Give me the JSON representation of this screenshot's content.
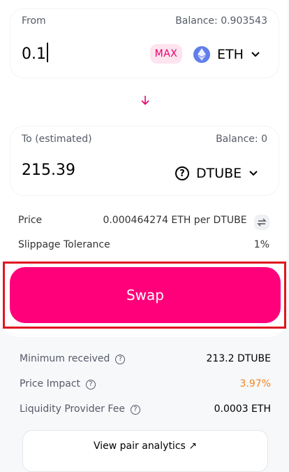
{
  "from": {
    "label": "From",
    "balance": "Balance: 0.903543",
    "amount": "0.1",
    "max_label": "MAX",
    "token": "ETH"
  },
  "to": {
    "label": "To (estimated)",
    "balance": "Balance: 0",
    "amount": "215.39",
    "token": "DTUBE"
  },
  "price": {
    "label": "Price",
    "value": "0.000464274 ETH per DTUBE"
  },
  "slippage": {
    "label": "Slippage Tolerance",
    "value": "1%"
  },
  "swap_label": "Swap",
  "details": {
    "min_received_label": "Minimum received",
    "min_received_value": "213.2 DTUBE",
    "price_impact_label": "Price Impact",
    "price_impact_value": "3.97%",
    "lp_fee_label": "Liquidity Provider Fee",
    "lp_fee_value": "0.0003 ETH"
  },
  "analytics_label": "View pair analytics ↗",
  "colors": {
    "accent": "#ff007a",
    "price_impact": "#f3841e",
    "eth": "#627eea"
  }
}
